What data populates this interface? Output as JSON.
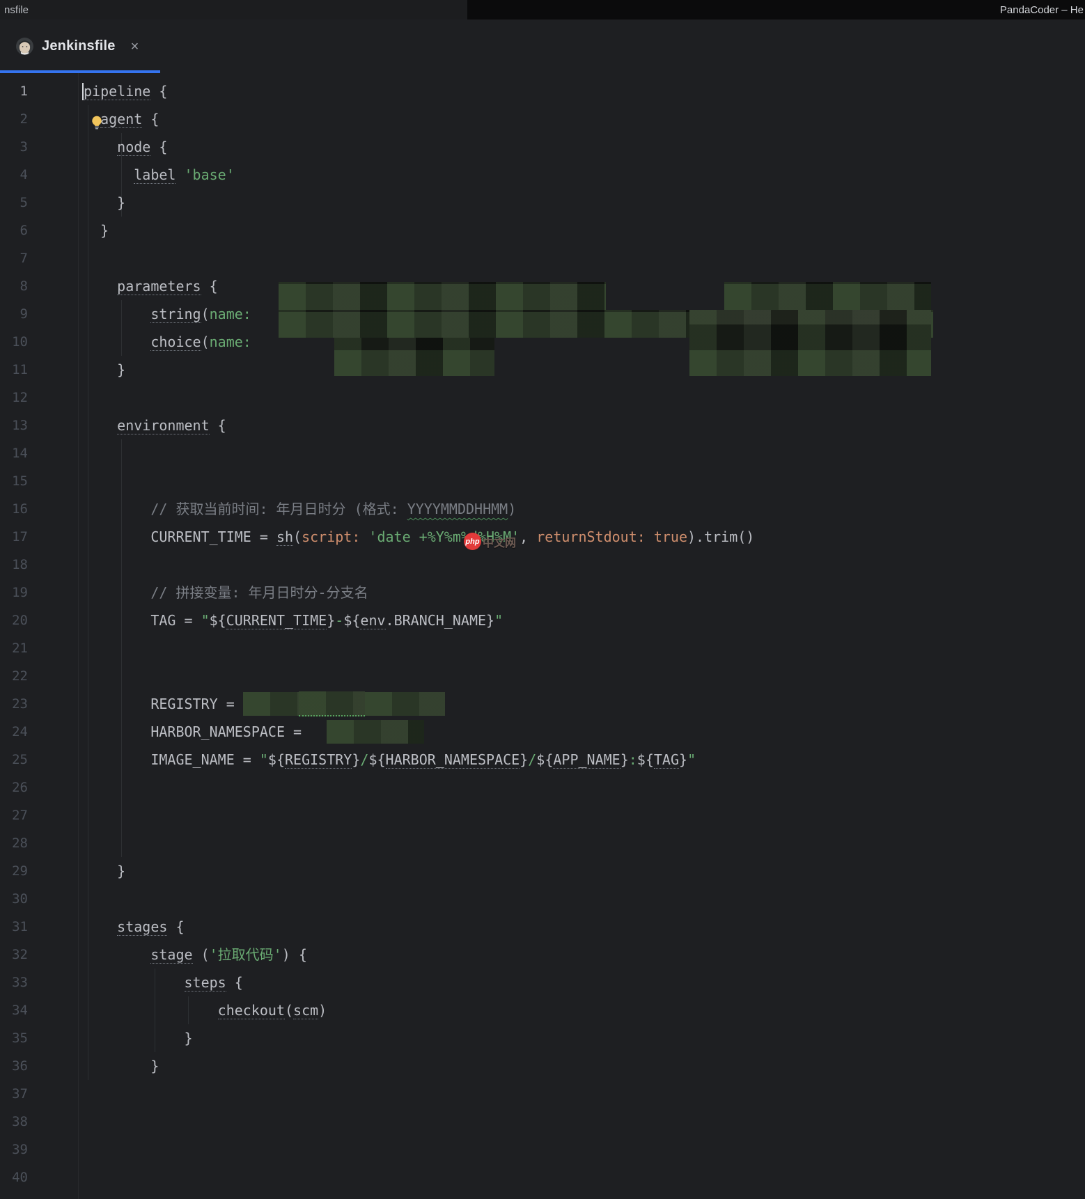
{
  "colors": {
    "accent_blue": "#3574F0",
    "editor_bg": "#1E1F22",
    "string_green": "#6AAB73",
    "named_arg_orange": "#CF8E6D",
    "comment_gray": "#7A7E85",
    "default_text": "#BCBEC4",
    "redact_green": "#20251E"
  },
  "window": {
    "title_left": "nsfile",
    "title_right": "PandaCoder – He"
  },
  "tab": {
    "label": "Jenkinsfile",
    "close_glyph": "×"
  },
  "watermark": {
    "badge": "php",
    "text": "中文网"
  },
  "editor": {
    "lines": [
      {
        "n": "1",
        "active": true,
        "caret": true,
        "seg": [
          {
            "t": "pipeline",
            "c": "u"
          },
          {
            "t": " {",
            "c": "p"
          }
        ]
      },
      {
        "n": "2",
        "bulb": true,
        "seg": [
          {
            "t": "  ",
            "c": "p"
          },
          {
            "t": "agent",
            "c": "u"
          },
          {
            "t": " {",
            "c": "p"
          }
        ]
      },
      {
        "n": "3",
        "seg": [
          {
            "t": "    ",
            "c": "p"
          },
          {
            "t": "node",
            "c": "u"
          },
          {
            "t": " {",
            "c": "p"
          }
        ]
      },
      {
        "n": "4",
        "seg": [
          {
            "t": "      ",
            "c": "p"
          },
          {
            "t": "label",
            "c": "u"
          },
          {
            "t": " ",
            "c": "p"
          },
          {
            "t": "'base'",
            "c": "s"
          }
        ]
      },
      {
        "n": "5",
        "seg": [
          {
            "t": "    }",
            "c": "p"
          }
        ]
      },
      {
        "n": "6",
        "seg": [
          {
            "t": "  }",
            "c": "p"
          }
        ]
      },
      {
        "n": "7",
        "seg": []
      },
      {
        "n": "8",
        "seg": [
          {
            "t": "    ",
            "c": "p"
          },
          {
            "t": "parameters",
            "c": "u"
          },
          {
            "t": " {",
            "c": "p"
          }
        ]
      },
      {
        "n": "9",
        "seg": [
          {
            "t": "        ",
            "c": "p"
          },
          {
            "t": "string",
            "c": "u"
          },
          {
            "t": "(",
            "c": "p"
          },
          {
            "t": "name:",
            "c": "s"
          }
        ]
      },
      {
        "n": "10",
        "seg": [
          {
            "t": "        ",
            "c": "p"
          },
          {
            "t": "choice",
            "c": "u"
          },
          {
            "t": "(",
            "c": "p"
          },
          {
            "t": "name:",
            "c": "s"
          }
        ]
      },
      {
        "n": "11",
        "seg": [
          {
            "t": "    }",
            "c": "p"
          }
        ]
      },
      {
        "n": "12",
        "seg": []
      },
      {
        "n": "13",
        "seg": [
          {
            "t": "    ",
            "c": "p"
          },
          {
            "t": "environment",
            "c": "u"
          },
          {
            "t": " {",
            "c": "p"
          }
        ]
      },
      {
        "n": "14",
        "seg": []
      },
      {
        "n": "15",
        "seg": []
      },
      {
        "n": "16",
        "seg": [
          {
            "t": "        ",
            "c": "p"
          },
          {
            "t": "// 获取当前时间: 年月日时分 (格式: ",
            "c": "c"
          },
          {
            "t": "YYYYMMDDHHMM",
            "c": "c w"
          },
          {
            "t": ")",
            "c": "c"
          }
        ]
      },
      {
        "n": "17",
        "seg": [
          {
            "t": "        ",
            "c": "p"
          },
          {
            "t": "CURRENT_TIME = ",
            "c": "p"
          },
          {
            "t": "sh",
            "c": "u"
          },
          {
            "t": "(",
            "c": "p"
          },
          {
            "t": "script: ",
            "c": "o"
          },
          {
            "t": "'date +%Y%m%d%H%M'",
            "c": "s"
          },
          {
            "t": ", ",
            "c": "p"
          },
          {
            "t": "returnStdout: ",
            "c": "o"
          },
          {
            "t": "true",
            "c": "o"
          },
          {
            "t": ").trim()",
            "c": "p"
          }
        ]
      },
      {
        "n": "18",
        "seg": []
      },
      {
        "n": "19",
        "seg": [
          {
            "t": "        ",
            "c": "p"
          },
          {
            "t": "// 拼接变量: 年月日时分-分支名",
            "c": "c"
          }
        ]
      },
      {
        "n": "20",
        "seg": [
          {
            "t": "        ",
            "c": "p"
          },
          {
            "t": "TAG = ",
            "c": "p"
          },
          {
            "t": "\"",
            "c": "s"
          },
          {
            "t": "${",
            "c": "p"
          },
          {
            "t": "CURRENT_TIME",
            "c": "u"
          },
          {
            "t": "}",
            "c": "p"
          },
          {
            "t": "-",
            "c": "s"
          },
          {
            "t": "${",
            "c": "p"
          },
          {
            "t": "env",
            "c": "u"
          },
          {
            "t": ".BRANCH_NAME",
            "c": "p"
          },
          {
            "t": "}",
            "c": "p"
          },
          {
            "t": "\"",
            "c": "s"
          }
        ]
      },
      {
        "n": "21",
        "seg": []
      },
      {
        "n": "22",
        "seg": []
      },
      {
        "n": "23",
        "seg": [
          {
            "t": "        ",
            "c": "p"
          },
          {
            "t": "REGISTRY = ",
            "c": "p"
          },
          {
            "m": 80
          },
          {
            "m": 95,
            "c": "dot"
          },
          {
            "m": 115
          }
        ]
      },
      {
        "n": "24",
        "seg": [
          {
            "t": "        ",
            "c": "p"
          },
          {
            "t": "HARBOR_NAMESPACE = ",
            "c": "p"
          },
          {
            "t": "  ",
            "c": "p"
          },
          {
            "m": 140
          }
        ]
      },
      {
        "n": "25",
        "seg": [
          {
            "t": "        ",
            "c": "p"
          },
          {
            "t": "IMAGE_NAME = ",
            "c": "p"
          },
          {
            "t": "\"",
            "c": "s"
          },
          {
            "t": "${",
            "c": "p"
          },
          {
            "t": "REGISTRY",
            "c": "u"
          },
          {
            "t": "}",
            "c": "p"
          },
          {
            "t": "/",
            "c": "s"
          },
          {
            "t": "${",
            "c": "p"
          },
          {
            "t": "HARBOR_NAMESPACE",
            "c": "u"
          },
          {
            "t": "}",
            "c": "p"
          },
          {
            "t": "/",
            "c": "s"
          },
          {
            "t": "${",
            "c": "p"
          },
          {
            "t": "APP_NAME",
            "c": "u"
          },
          {
            "t": "}",
            "c": "p"
          },
          {
            "t": ":",
            "c": "s"
          },
          {
            "t": "${",
            "c": "p"
          },
          {
            "t": "TAG",
            "c": "u"
          },
          {
            "t": "}",
            "c": "p"
          },
          {
            "t": "\"",
            "c": "s"
          }
        ]
      },
      {
        "n": "26",
        "seg": []
      },
      {
        "n": "27",
        "seg": []
      },
      {
        "n": "28",
        "seg": []
      },
      {
        "n": "29",
        "seg": [
          {
            "t": "    }",
            "c": "p"
          }
        ]
      },
      {
        "n": "30",
        "seg": []
      },
      {
        "n": "31",
        "seg": [
          {
            "t": "    ",
            "c": "p"
          },
          {
            "t": "stages",
            "c": "u"
          },
          {
            "t": " {",
            "c": "p"
          }
        ]
      },
      {
        "n": "32",
        "seg": [
          {
            "t": "        ",
            "c": "p"
          },
          {
            "t": "stage",
            "c": "u"
          },
          {
            "t": " (",
            "c": "p"
          },
          {
            "t": "'拉取代码'",
            "c": "s"
          },
          {
            "t": ") {",
            "c": "p"
          }
        ]
      },
      {
        "n": "33",
        "seg": [
          {
            "t": "            ",
            "c": "p"
          },
          {
            "t": "steps",
            "c": "u"
          },
          {
            "t": " {",
            "c": "p"
          }
        ]
      },
      {
        "n": "34",
        "seg": [
          {
            "t": "                ",
            "c": "p"
          },
          {
            "t": "checkout",
            "c": "u"
          },
          {
            "t": "(",
            "c": "p"
          },
          {
            "t": "scm",
            "c": "u"
          },
          {
            "t": ")",
            "c": "p"
          }
        ]
      },
      {
        "n": "35",
        "seg": [
          {
            "t": "            }",
            "c": "p"
          }
        ]
      },
      {
        "n": "36",
        "seg": [
          {
            "t": "        }",
            "c": "p"
          }
        ]
      },
      {
        "n": "37",
        "seg": []
      },
      {
        "n": "38",
        "seg": []
      },
      {
        "n": "39",
        "seg": []
      },
      {
        "n": "40",
        "seg": []
      }
    ]
  }
}
